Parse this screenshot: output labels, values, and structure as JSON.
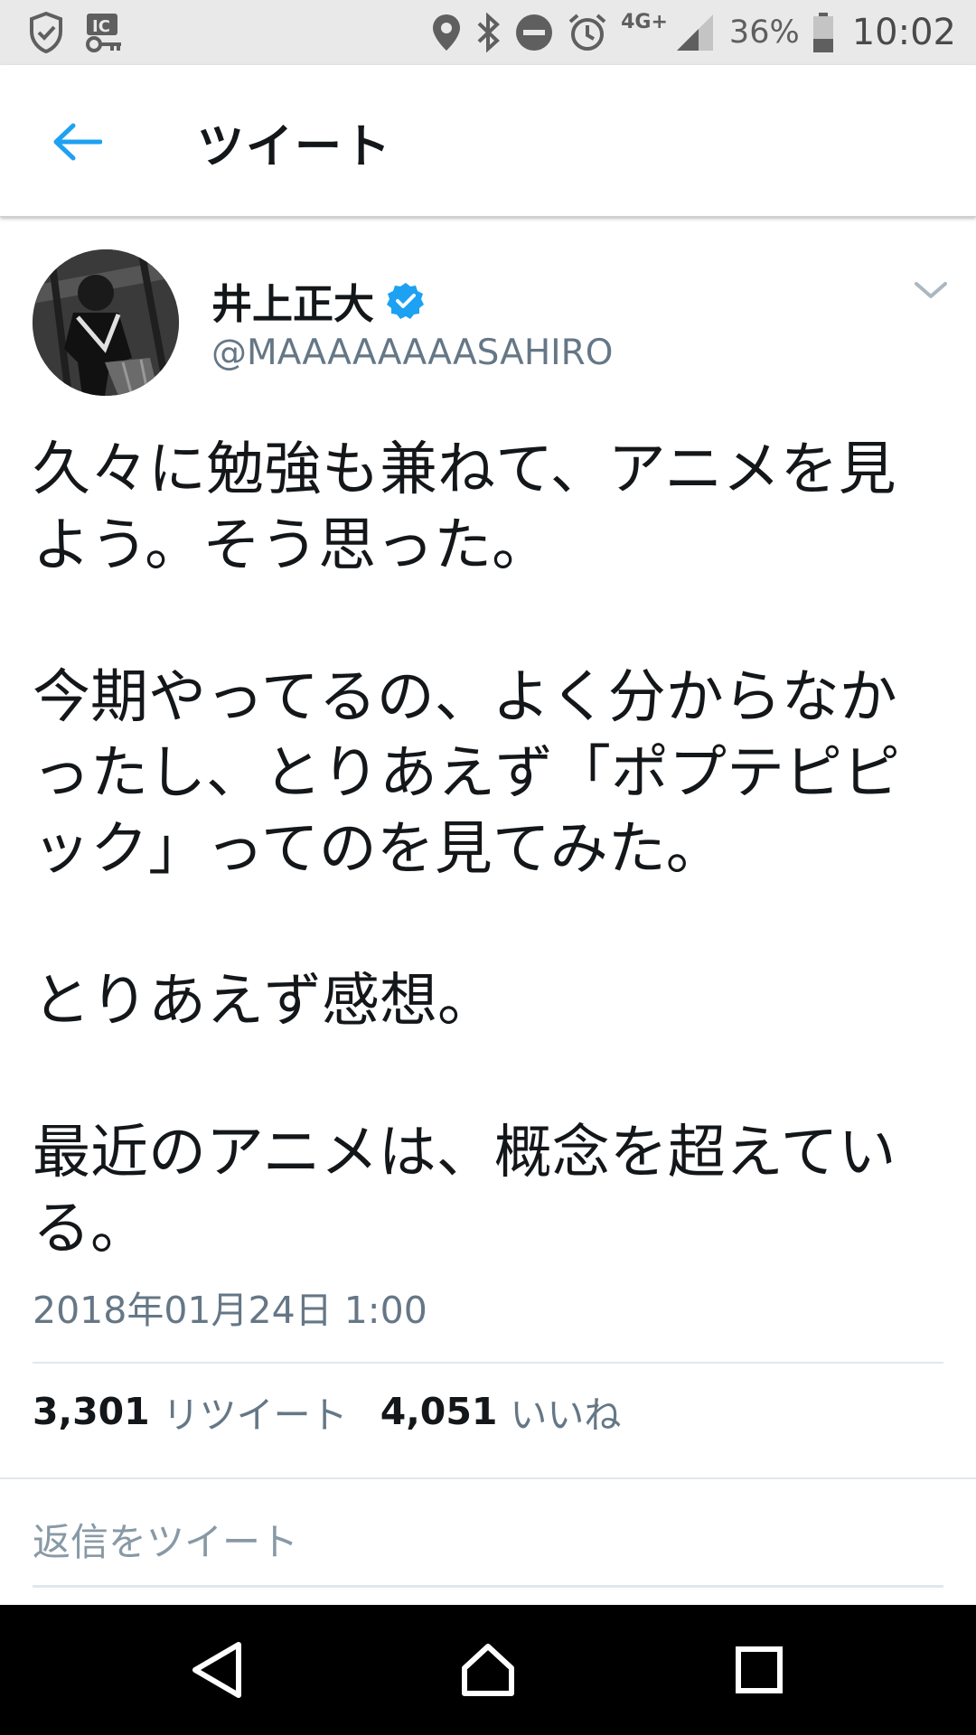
{
  "status_bar": {
    "network": "4G+",
    "battery_percent": "36%",
    "time": "10:02",
    "icons": [
      "shield-check-icon",
      "ic-key-icon",
      "location-icon",
      "bluetooth-icon",
      "do-not-disturb-icon",
      "alarm-icon",
      "signal-icon",
      "battery-icon"
    ]
  },
  "app_bar": {
    "title": "ツイート"
  },
  "tweet": {
    "author_name": "井上正大",
    "handle": "@MAAAAAAAASAHIRO",
    "verified": true,
    "text": "久々に勉強も兼ねて、アニメを見よう。そう思った。\n\n今期やってるの、よく分からなかったし、とりあえず「ポプテピピック」ってのを見てみた。\n\nとりあえず感想。\n\n最近のアニメは、概念を超えている。",
    "timestamp": "2018年01月24日 1:00",
    "retweet_count": "3,301",
    "retweet_label": "リツイート",
    "like_count": "4,051",
    "like_label": "いいね"
  },
  "reply": {
    "placeholder": "返信をツイート"
  },
  "colors": {
    "accent": "#1da1f2",
    "text_primary": "#14171a",
    "text_secondary": "#657786",
    "status_bar_bg": "#e9e9e9",
    "nav_bar_bg": "#000000"
  }
}
